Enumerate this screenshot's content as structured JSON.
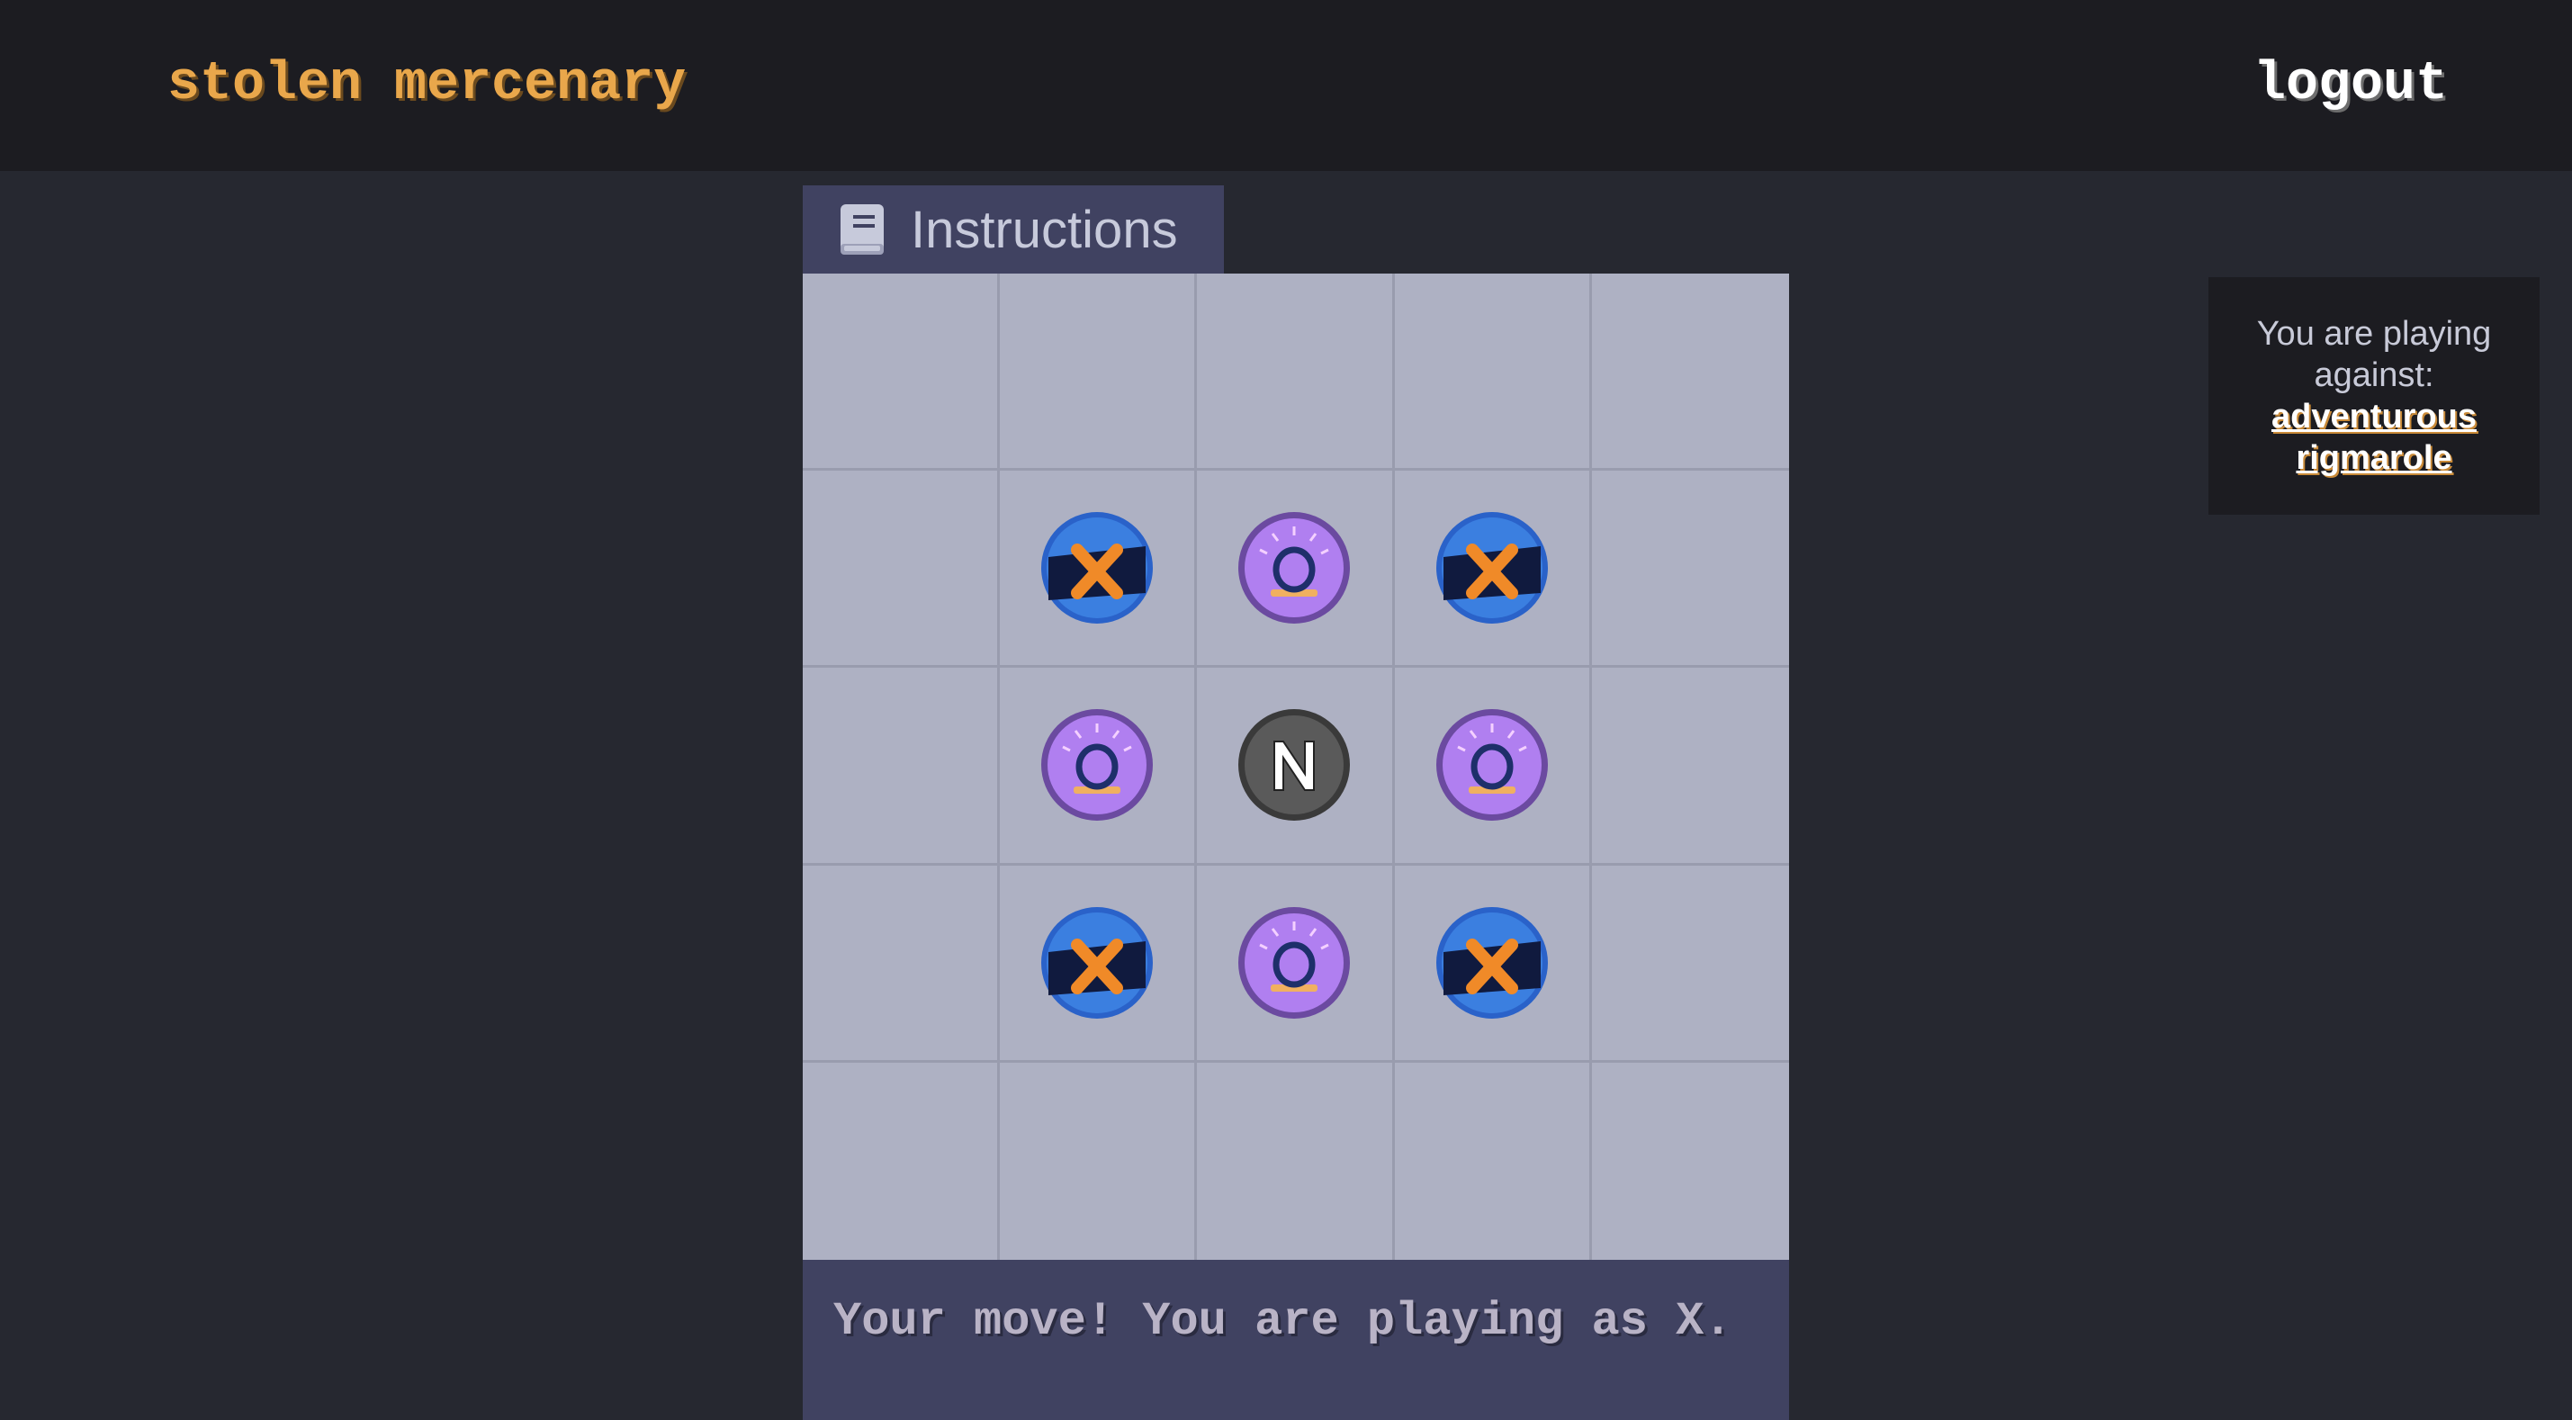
{
  "header": {
    "brand": "stolen mercenary",
    "logout_label": "logout"
  },
  "instructions_tab": {
    "label": "Instructions",
    "icon": "book-icon"
  },
  "board": {
    "rows": 5,
    "cols": 5,
    "cells": [
      [
        "",
        "",
        "",
        "",
        ""
      ],
      [
        "",
        "X",
        "O",
        "X",
        ""
      ],
      [
        "",
        "O",
        "N",
        "O",
        ""
      ],
      [
        "",
        "X",
        "O",
        "X",
        ""
      ],
      [
        "",
        "",
        "",
        "",
        ""
      ]
    ]
  },
  "status": {
    "text": "Your move! You are playing as X."
  },
  "opponent": {
    "label": "You are playing against:",
    "name": "adventurous rigmarole"
  },
  "colors": {
    "brand": "#e9a74b",
    "board": "#aeb1c3",
    "panel": "#404261",
    "x_cap": "#3b7fe0",
    "o_cap": "#b07ff0",
    "n_cap": "#5a5a5a"
  }
}
